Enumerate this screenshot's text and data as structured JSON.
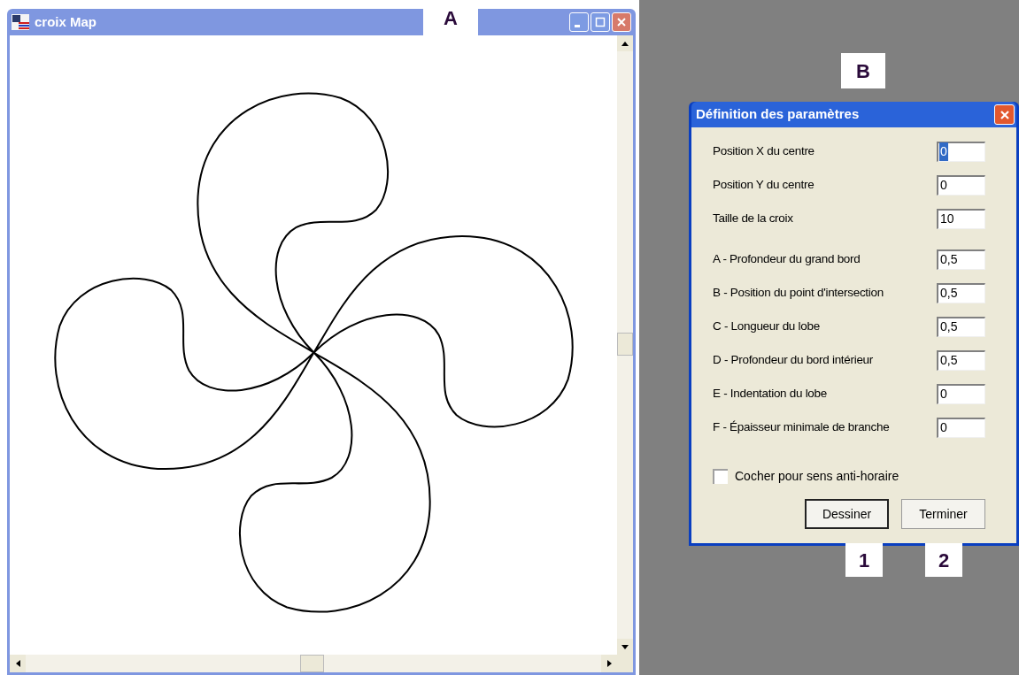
{
  "map_window": {
    "title": "croix Map"
  },
  "dialog": {
    "title": "Définition des paramètres",
    "field_groups": [
      [
        {
          "label": "Position X du centre",
          "value": "0",
          "text_selected": true
        },
        {
          "label": "Position Y du centre",
          "value": "0",
          "text_selected": false
        },
        {
          "label": "Taille de la croix",
          "value": "10",
          "text_selected": false
        }
      ],
      [
        {
          "label": "A - Profondeur du grand bord",
          "value": "0,5",
          "text_selected": false
        },
        {
          "label": "B - Position du point d'intersection",
          "value": "0,5",
          "text_selected": false
        },
        {
          "label": "C - Longueur du lobe",
          "value": "0,5",
          "text_selected": false
        },
        {
          "label": "D - Profondeur du bord intérieur",
          "value": "0,5",
          "text_selected": false
        },
        {
          "label": "E - Indentation du lobe",
          "value": "0",
          "text_selected": false
        },
        {
          "label": "F - Épaisseur minimale de branche",
          "value": "0",
          "text_selected": false
        }
      ]
    ],
    "checkbox": {
      "label": "Cocher pour sens anti-horaire",
      "checked": false
    },
    "buttons": [
      {
        "label": "Dessiner",
        "focused": true
      },
      {
        "label": "Terminer",
        "focused": false
      }
    ]
  },
  "callouts": [
    {
      "text": "A"
    },
    {
      "text": "B"
    },
    {
      "text": "1"
    },
    {
      "text": "2"
    }
  ]
}
